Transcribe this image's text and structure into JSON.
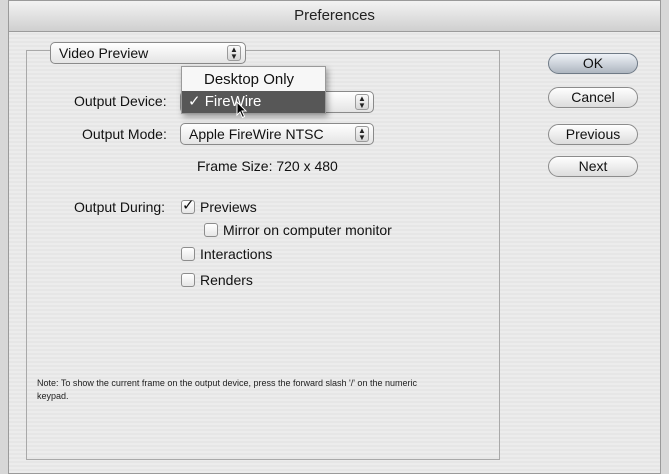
{
  "window": {
    "title": "Preferences"
  },
  "section": {
    "selected": "Video Preview"
  },
  "output_device": {
    "label": "Output Device:",
    "menu_items": [
      "Desktop Only",
      "FireWire"
    ],
    "selected_item": "✓ FireWire"
  },
  "output_mode": {
    "label": "Output Mode:",
    "value": "Apple FireWire NTSC"
  },
  "frame_size": "Frame Size: 720 x 480",
  "output_during": {
    "label": "Output During:",
    "previews": "Previews",
    "mirror": "Mirror on computer monitor",
    "interactions": "Interactions",
    "renders": "Renders"
  },
  "note": "Note:  To show the current frame on the output device, press the forward slash '/' on the numeric keypad.",
  "buttons": {
    "ok": "OK",
    "cancel": "Cancel",
    "previous": "Previous",
    "next": "Next"
  },
  "icons": [
    "chevron-updown-icon",
    "checkmark-icon",
    "cursor-arrow-icon"
  ]
}
